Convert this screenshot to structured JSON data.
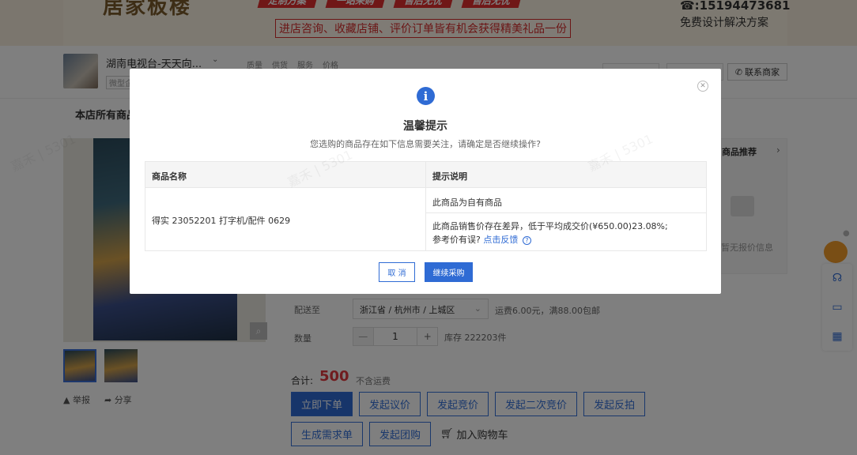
{
  "banner": {
    "logo": "居家板楼",
    "badges": [
      "定制方案",
      "一站采购",
      "售后无忧",
      "售后无忧"
    ],
    "promo": "进店咨询、收藏店铺、评价订单皆有机会获得精美礼品一份",
    "phone": "☎:15194473681",
    "phone_sub": "免费设计解决方案"
  },
  "shop": {
    "name": "湖南电视台-天天向...",
    "tag": "微型企",
    "metrics": [
      "质量",
      "供货",
      "服务",
      "价格"
    ],
    "contact_label": "联系商家",
    "nav_all": "本店所有商品"
  },
  "recommend": {
    "title": "商品推荐",
    "empty": "暂无报价信息"
  },
  "product": {
    "ship_label": "配送至",
    "ship_to": "浙江省 / 杭州市 / 上城区",
    "ship_fee": "运费6.00元，满88.00包邮",
    "qty_label": "数量",
    "qty_value": "1",
    "stock": "库存 222203件",
    "total_label": "合计:",
    "total_value": "500",
    "total_note": "不含运费",
    "report": "举报",
    "share": "分享"
  },
  "actions": {
    "row1": [
      "立即下单",
      "发起议价",
      "发起竞价",
      "发起二次竞价",
      "发起反拍"
    ],
    "row2": [
      "生成需求单",
      "发起团购"
    ],
    "cart": "加入购物车"
  },
  "modal": {
    "title": "温馨提示",
    "subtitle": "您选购的商品存在如下信息需要关注，请确定是否继续操作?",
    "col_name": "商品名称",
    "col_tip": "提示说明",
    "product_name": "得实 23052201 打字机/配件 0629",
    "tip1": "此商品为自有商品",
    "tip2": "此商品销售价存在差异，低于平均成交价(¥650.00)23.08%;",
    "tip3_prefix": "参考价有误?",
    "tip3_link": "点击反馈",
    "cancel": "取 消",
    "confirm": "继续采购"
  },
  "watermark": "嘉禾 | 5301",
  "colors": {
    "primary": "#2f6bd4",
    "price": "#e0393e",
    "banner_red": "#e02f2f"
  }
}
